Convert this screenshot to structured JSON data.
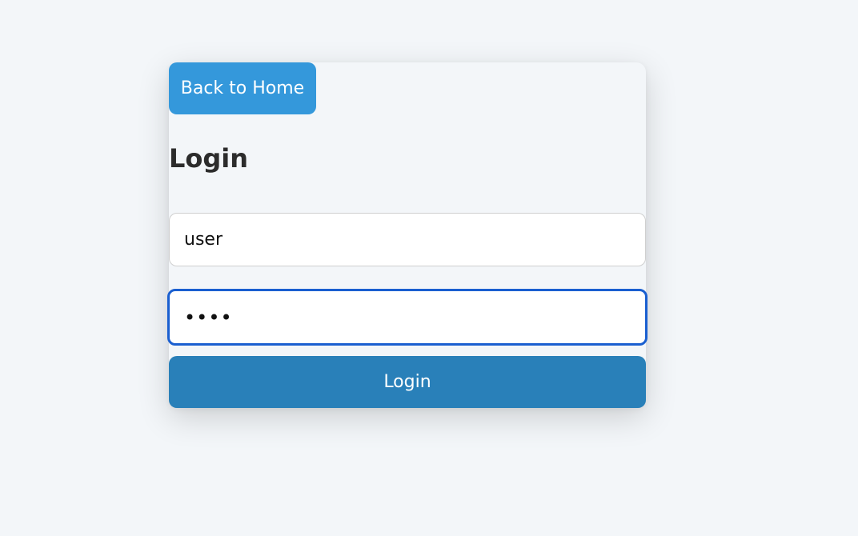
{
  "nav": {
    "back_label": "Back to Home"
  },
  "form": {
    "title": "Login",
    "username": {
      "value": "user"
    },
    "password": {
      "value": "pass"
    },
    "submit_label": "Login"
  },
  "colors": {
    "background": "#f3f6f9",
    "back_button": "#3498db",
    "login_button": "#2980b9",
    "focus_border": "#1a5fd0"
  }
}
